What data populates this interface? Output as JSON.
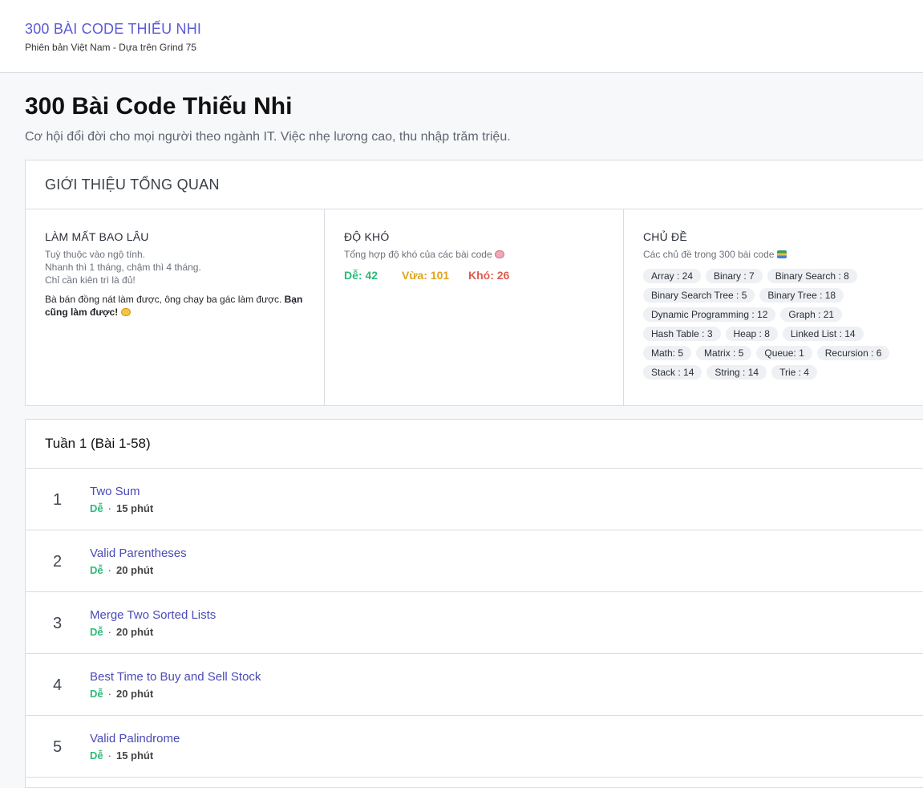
{
  "header": {
    "brand": "300 BÀI CODE THIẾU NHI",
    "subtitle": "Phiên bản Việt Nam - Dựa trên Grind 75"
  },
  "page": {
    "title": "300 Bài Code Thiếu Nhi",
    "description": "Cơ hội đổi đời cho mọi người theo ngành IT. Việc nhẹ lương cao, thu nhập trăm triệu."
  },
  "overview": {
    "title": "GIỚI THIỆU TỔNG QUAN",
    "duration": {
      "title": "LÀM MẤT BAO LÂU",
      "lines": [
        "Tuỳ thuộc vào ngộ tính.",
        "Nhanh thì 1 tháng, chậm thì 4 tháng.",
        "Chỉ cần kiên trì là đủ!"
      ],
      "quote_start": "Bà bán đồng nát làm được, ông chạy ba gác làm được. ",
      "quote_bold": "Bạn cũng làm được!",
      "quote_icon": "flexed-fist-icon"
    },
    "difficulty": {
      "title": "ĐỘ KHÓ",
      "subtitle": "Tổng hợp độ khó của các bài code",
      "subtitle_icon": "brain-icon",
      "easy": "Dễ: 42",
      "medium": "Vừa: 101",
      "hard": "Khó: 26",
      "colors": {
        "easy": "#2dba7a",
        "medium": "#e0a21a",
        "hard": "#e05a4e"
      }
    },
    "topics": {
      "title": "CHỦ ĐỀ",
      "subtitle": "Các chủ đề trong 300 bài code",
      "subtitle_icon": "books-icon",
      "tags": [
        "Array : 24",
        "Binary : 7",
        "Binary Search : 8",
        "Binary Search Tree : 5",
        "Binary Tree : 18",
        "Dynamic Programming : 12",
        "Graph : 21",
        "Hash Table : 3",
        "Heap : 8",
        "Linked List : 14",
        "Math: 5",
        "Matrix : 5",
        "Queue: 1",
        "Recursion : 6",
        "Stack : 14",
        "String : 14",
        "Trie : 4"
      ]
    }
  },
  "week": {
    "title": "Tuần 1 (Bài 1-58)",
    "problems": [
      {
        "num": "1",
        "name": "Two Sum",
        "level": "Dễ",
        "sep": "·",
        "time": "15 phút"
      },
      {
        "num": "2",
        "name": "Valid Parentheses",
        "level": "Dễ",
        "sep": "·",
        "time": "20 phút"
      },
      {
        "num": "3",
        "name": "Merge Two Sorted Lists",
        "level": "Dễ",
        "sep": "·",
        "time": "20 phút"
      },
      {
        "num": "4",
        "name": "Best Time to Buy and Sell Stock",
        "level": "Dễ",
        "sep": "·",
        "time": "20 phút"
      },
      {
        "num": "5",
        "name": "Valid Palindrome",
        "level": "Dễ",
        "sep": "·",
        "time": "15 phút"
      }
    ]
  },
  "colors": {
    "accent": "#5b5bd6",
    "link": "#4a4ab8",
    "easy": "#2dba7a"
  }
}
